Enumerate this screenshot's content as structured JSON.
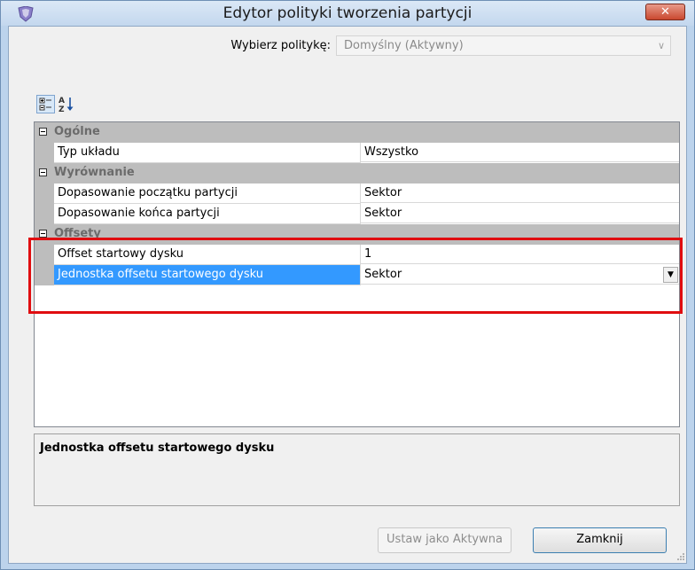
{
  "window": {
    "title": "Edytor polityki tworzenia partycji",
    "close_label": "✕"
  },
  "policy": {
    "label": "Wybierz politykę:",
    "value": "Domyślny (Aktywny)"
  },
  "toolbar": {
    "categorized_icon": "categorized-view-icon",
    "alphabetical_icon": "sort-alphabetical-icon"
  },
  "grid": {
    "categories": [
      {
        "name": "Ogólne",
        "properties": [
          {
            "name": "Typ układu",
            "value": "Wszystko"
          }
        ]
      },
      {
        "name": "Wyrównanie",
        "properties": [
          {
            "name": "Dopasowanie początku partycji",
            "value": "Sektor"
          },
          {
            "name": "Dopasowanie końca partycji",
            "value": "Sektor"
          }
        ]
      },
      {
        "name": "Offsety",
        "properties": [
          {
            "name": "Offset startowy dysku",
            "value": "1"
          },
          {
            "name": "Jednostka offsetu startowego dysku",
            "value": "Sektor",
            "selected": true
          }
        ]
      }
    ]
  },
  "description": {
    "title": "Jednostka offsetu startowego dysku"
  },
  "buttons": {
    "activate": "Ustaw jako Aktywna",
    "close": "Zamknij"
  },
  "colors": {
    "highlight": "#e00d10",
    "selection": "#3399ff",
    "category_band": "#bdbdbd"
  }
}
